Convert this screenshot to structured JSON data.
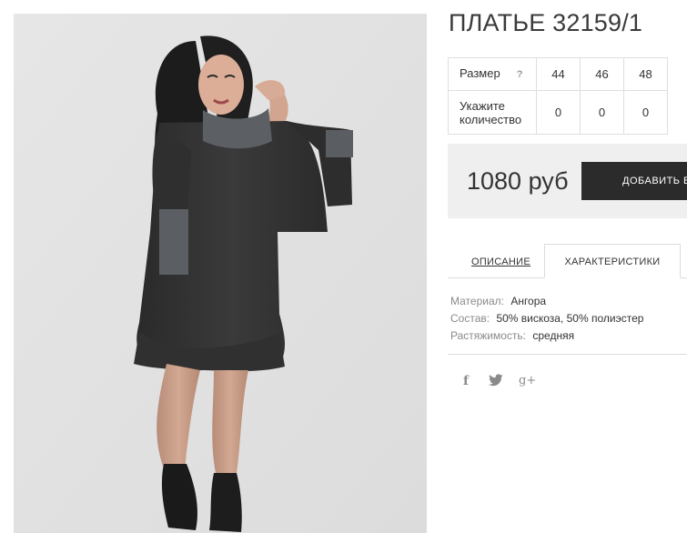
{
  "product": {
    "title": "ПЛАТЬЕ 32159/1",
    "image_alt": "dress-photo"
  },
  "sizes_table": {
    "size_label": "Размер",
    "help_mark": "?",
    "quantity_label_line1": "Укажите",
    "quantity_label_line2": "количество",
    "sizes": [
      "44",
      "46",
      "48"
    ],
    "quantities": [
      "0",
      "0",
      "0"
    ]
  },
  "purchase": {
    "price": "1080 руб",
    "button_label": "ДОБАВИТЬ В КОРЗИНУ",
    "button_color": "#2b2b2b"
  },
  "tabs": {
    "description": "ОПИСАНИЕ",
    "characteristics": "ХАРАКТЕРИСТИКИ",
    "active": "characteristics"
  },
  "properties": [
    {
      "key": "Материал:",
      "value": "Ангора"
    },
    {
      "key": "Состав:",
      "value": "50% вискоза, 50% полиэстер"
    },
    {
      "key": "Растяжимость:",
      "value": "средняя"
    }
  ],
  "social": {
    "facebook": "f",
    "twitter": "facebook-icon",
    "googleplus": "g+"
  }
}
